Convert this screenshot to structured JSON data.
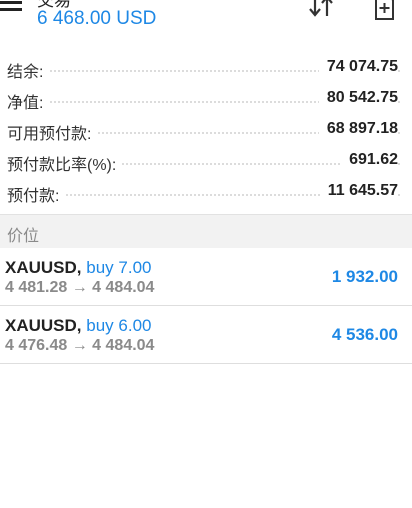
{
  "header": {
    "title": "交易",
    "balance_line": "6 468.00 USD",
    "sort_icon": "sort-arrows-icon",
    "new_order_icon": "new-order-icon",
    "menu_icon": "hamburger-menu-icon"
  },
  "summary": [
    {
      "label": "结余:",
      "value": "74 074.75"
    },
    {
      "label": "净值:",
      "value": "80 542.75"
    },
    {
      "label": "可用预付款:",
      "value": "68 897.18"
    },
    {
      "label": "预付款比率(%):",
      "value": "691.62"
    },
    {
      "label": "预付款:",
      "value": "11 645.57"
    }
  ],
  "section": {
    "label": "价位"
  },
  "positions": [
    {
      "symbol": "XAUUSD",
      "sep": ",",
      "side": "buy 7.00",
      "prices": "4 481.28 → 4 484.04",
      "profit": "1 932.00"
    },
    {
      "symbol": "XAUUSD",
      "sep": ",",
      "side": "buy 6.00",
      "prices": "4 476.48 → 4 484.04",
      "profit": "4 536.00"
    }
  ],
  "colors": {
    "accent": "#1e88e5",
    "text": "#222222",
    "muted": "#8a8a8a",
    "section_bg": "#f2f2f2"
  }
}
